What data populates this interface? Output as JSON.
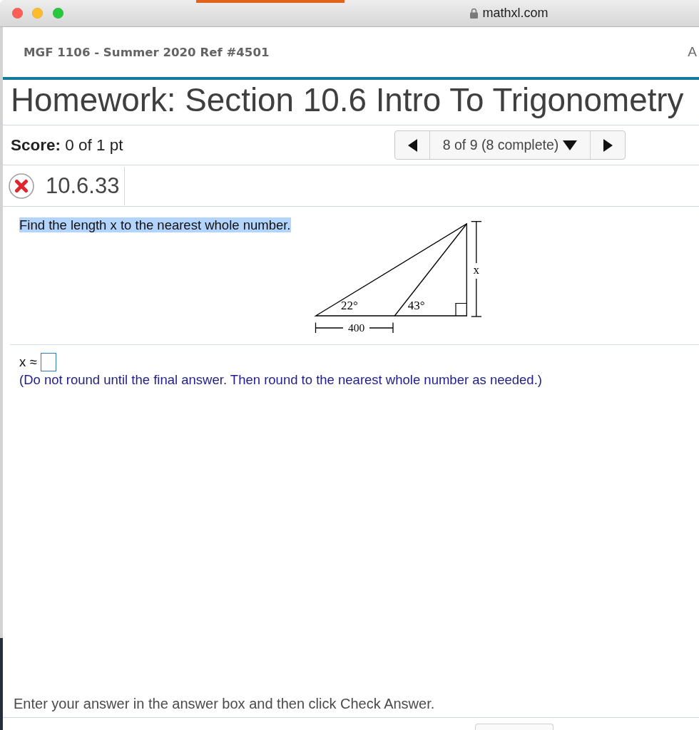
{
  "browser": {
    "url": "mathxl.com"
  },
  "header": {
    "course": "MGF 1106 - Summer 2020 Ref #4501",
    "trailing_text": "A"
  },
  "title": "Homework: Section 10.6 Intro To Trigonometry",
  "score": "**Score:** 0 of 1 pt",
  "navigator": {
    "position": "8 of 9 (8 complete)"
  },
  "question": {
    "number": "10.6.33",
    "correct": false,
    "prompt": {
      "text": "Find the length x to the nearest whole number.",
      "highlighted": true
    },
    "figure": {
      "left_angle": "22°",
      "inner_angle": "43°",
      "height_label": "x",
      "base_label": "400"
    },
    "answer": {
      "label": "x ≈"
    },
    "hint": "(Do not round until the final answer. Then round to the nearest whole number as needed.)"
  },
  "footer": {
    "instruction": "Enter your answer in the answer box and then click Check Answer."
  }
}
